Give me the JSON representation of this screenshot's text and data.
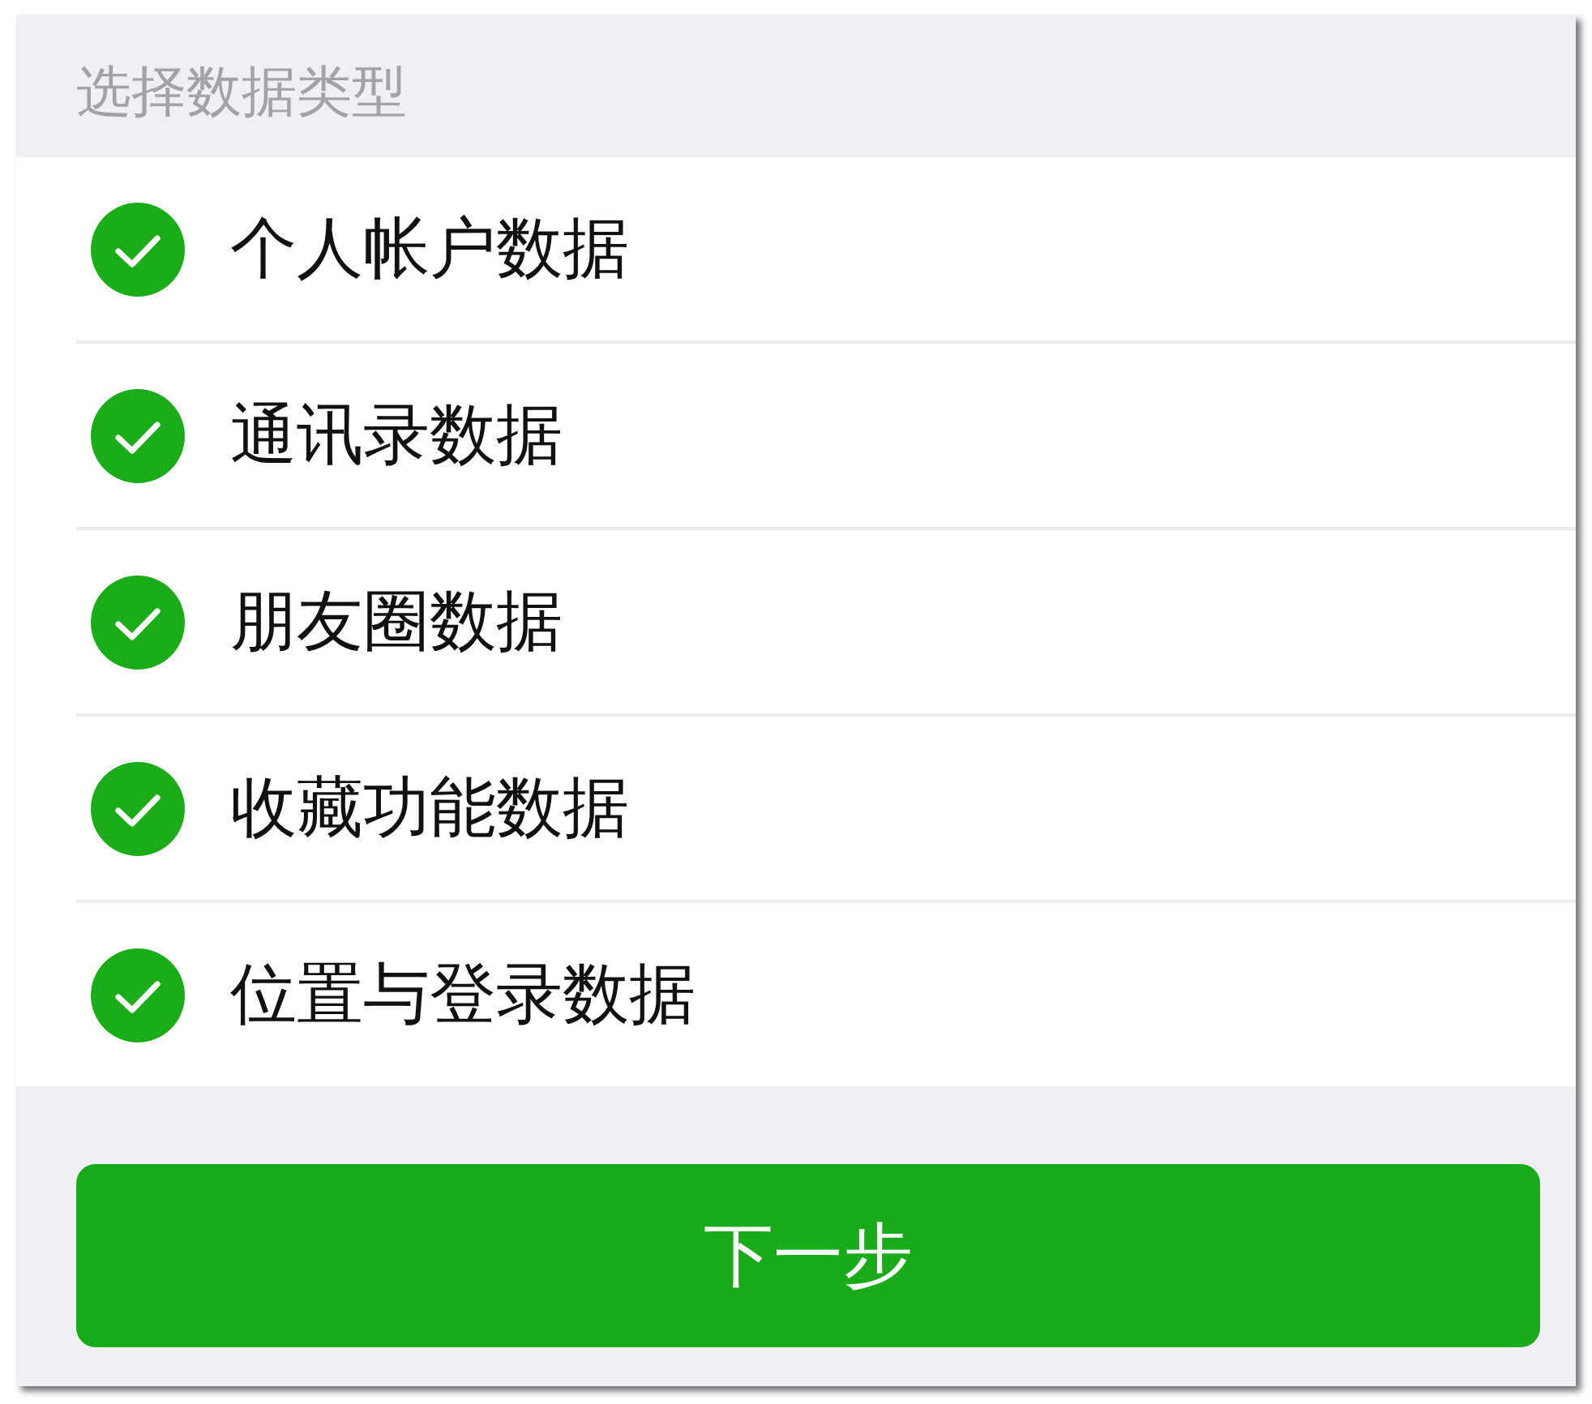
{
  "header": {
    "title": "选择数据类型"
  },
  "options": [
    {
      "label": "个人帐户数据",
      "checked": true
    },
    {
      "label": "通讯录数据",
      "checked": true
    },
    {
      "label": "朋友圈数据",
      "checked": true
    },
    {
      "label": "收藏功能数据",
      "checked": true
    },
    {
      "label": "位置与登录数据",
      "checked": true
    }
  ],
  "next_button": {
    "label": "下一步"
  }
}
